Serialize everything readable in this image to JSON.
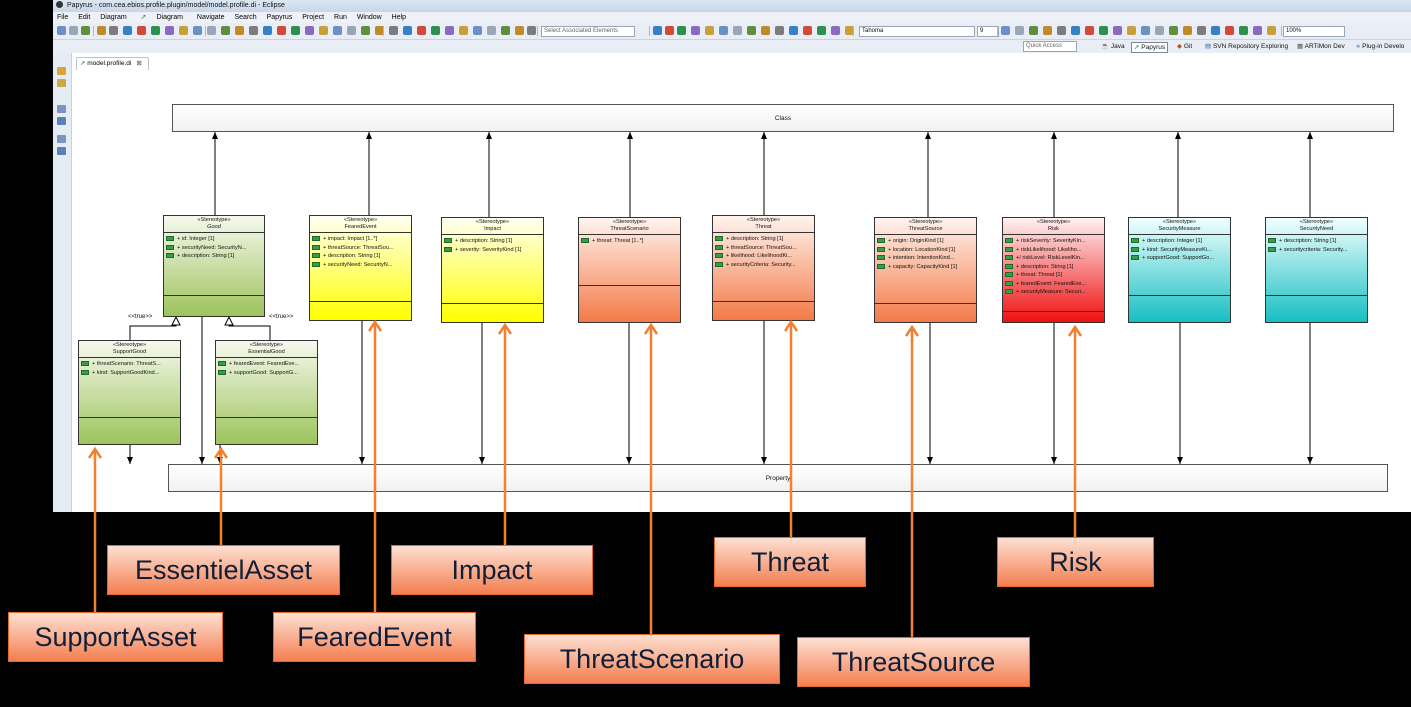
{
  "window": {
    "title": "Papyrus - com.cea.ebios.profile.plugin/model/model.profile.di - Eclipse"
  },
  "menu": [
    "File",
    "Edit",
    "Diagram",
    "Diagram",
    "Navigate",
    "Search",
    "Papyrus",
    "Project",
    "Run",
    "Window",
    "Help"
  ],
  "toolbar": {
    "select_placeholder": "Select Associated Elements",
    "font_name": "Tahoma",
    "font_size": "9",
    "zoom": "100%",
    "quick_access": "Quick Access"
  },
  "perspectives": [
    "Java",
    "Papyrus",
    "Git",
    "SVN Repository Exploring",
    "ARTiMon Dev",
    "Plug-in Develo"
  ],
  "editor_tab": {
    "label": "model.profile.di",
    "close": "⊠"
  },
  "diagram": {
    "metaclass_top": "Class",
    "metaclass_bottom": "Property",
    "true_label": "<<true>>",
    "stereotypes": [
      {
        "id": "good",
        "keyword": "«Stereotype»",
        "name": "Good",
        "abstract": true,
        "color": "#9dc45c",
        "attrs": [
          "+ id: Integer [1]",
          "+ securityNeed: SecurityN...",
          "+ description: String [1]"
        ]
      },
      {
        "id": "feared",
        "keyword": "«Stereotype»",
        "name": "FearedEvent",
        "abstract": false,
        "color": "#ffff00",
        "attrs": [
          "+ impact: Impact [1..*]",
          "+ threatSource: ThreatSou...",
          "+ description: String [1]",
          "+ securityNeed: SecurityN..."
        ]
      },
      {
        "id": "impact",
        "keyword": "«Stereotype»",
        "name": "Impact",
        "abstract": false,
        "color": "#ffff00",
        "attrs": [
          "+ description: String [1]",
          "+ severity: SeverityKind [1]"
        ]
      },
      {
        "id": "scenario",
        "keyword": "«Stereotype»",
        "name": "ThreatScenario",
        "abstract": false,
        "color": "#f37a48",
        "attrs": [
          "+ threat: Threat [1..*]"
        ]
      },
      {
        "id": "threat",
        "keyword": "«Stereotype»",
        "name": "Threat",
        "abstract": false,
        "color": "#f37a48",
        "attrs": [
          "+ description: String [1]",
          "+ threatSource: ThreatSou...",
          "+ likelihood: LikelihoodKi...",
          "+ securityCriteria: Security..."
        ]
      },
      {
        "id": "source",
        "keyword": "«Stereotype»",
        "name": "ThreatSource",
        "abstract": false,
        "color": "#f37a48",
        "attrs": [
          "+ origin: OriginKind [1]",
          "+ location: LocationKind [1]",
          "+ intention: IntentionKind...",
          "+ capacity: CapacityKind [1]"
        ]
      },
      {
        "id": "risk",
        "keyword": "«Stereotype»",
        "name": "Risk",
        "abstract": false,
        "color": "#ef1010",
        "attrs": [
          "+ riskSeverity: SeverityKin...",
          "+ riskLikelihood: Likeliho...",
          "+/ riskLevel: RiskLevelKin...",
          "+ description: String [1]",
          "+ threat: Threat [1]",
          "+ fearedEvent: FearedEve...",
          "+ securityMeasure: Securi..."
        ]
      },
      {
        "id": "measure",
        "keyword": "«Stereotype»",
        "name": "SecurityMeasure",
        "abstract": false,
        "color": "#16bfc2",
        "attrs": [
          "+ description: Integer [1]",
          "+ kind: SecurityMeasureKi...",
          "+ supportGood: SupportGo..."
        ]
      },
      {
        "id": "need",
        "keyword": "«Stereotype»",
        "name": "SecurityNeed",
        "abstract": false,
        "color": "#16bfc2",
        "attrs": [
          "+ description: String [1]",
          "+ securitycriteria: Security..."
        ]
      },
      {
        "id": "support",
        "keyword": "«Stereotype»",
        "name": "SupportGood",
        "abstract": false,
        "color": "#9dc45c",
        "attrs": [
          "+ threatScenario: ThreatS...",
          "+ kind: SupportGoodKind..."
        ]
      },
      {
        "id": "essential",
        "keyword": "«Stereotype»",
        "name": "EssentialGood",
        "abstract": false,
        "color": "#9dc45c",
        "attrs": [
          "+ fearedEvent: FearedEve...",
          "+ supportGood: SupportG..."
        ]
      }
    ]
  },
  "callouts": [
    {
      "id": "essentiel",
      "label": "EssentielAsset"
    },
    {
      "id": "impact",
      "label": "Impact"
    },
    {
      "id": "threat",
      "label": "Threat"
    },
    {
      "id": "risk",
      "label": "Risk"
    },
    {
      "id": "support",
      "label": "SupportAsset"
    },
    {
      "id": "feared",
      "label": "FearedEvent"
    },
    {
      "id": "scenario",
      "label": "ThreatScenario"
    },
    {
      "id": "source",
      "label": "ThreatSource"
    }
  ],
  "colors": {
    "callout_fill": "#f47f50",
    "callout_arrow": "#f47f2e",
    "callout_text": "#0f1f3a"
  }
}
